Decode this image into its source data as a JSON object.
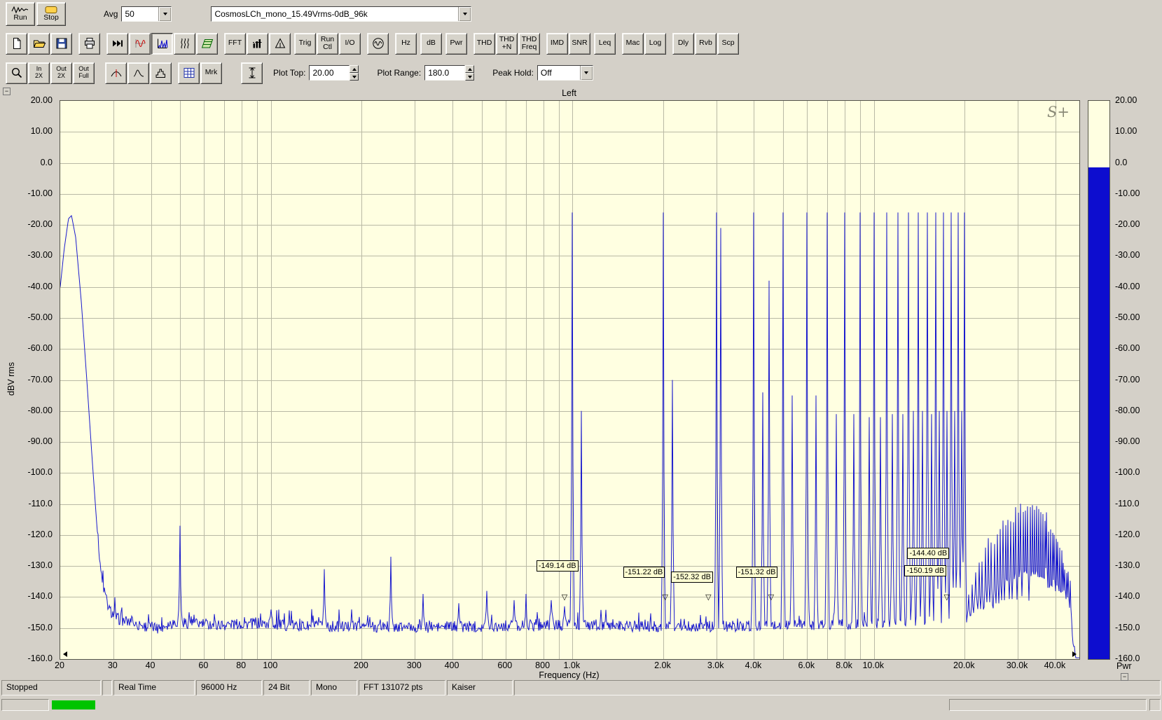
{
  "toolbar1": {
    "run_label": "Run",
    "stop_label": "Stop",
    "avg_label": "Avg",
    "avg_value": "50",
    "file_value": "CosmosLCh_mono_15.49Vrms-0dB_96k"
  },
  "toolbar2": {
    "buttons": [
      {
        "name": "new-file-button",
        "icon": "new-document-icon"
      },
      {
        "name": "open-file-button",
        "icon": "open-folder-icon"
      },
      {
        "name": "save-button",
        "icon": "save-icon"
      },
      {
        "name": "print-button",
        "icon": "printer-icon"
      },
      {
        "name": "process-button",
        "icon": "fast-forward-icon"
      },
      {
        "name": "time-series-view-button",
        "icon": "time-series-icon"
      },
      {
        "name": "spectrum-view-button",
        "icon": "spectrum-icon",
        "active": true
      },
      {
        "name": "spectrogram-view-button",
        "icon": "spectrogram-icon"
      },
      {
        "name": "surface-view-button",
        "icon": "surface-plot-icon"
      },
      {
        "name": "fft-settings-button",
        "label": "FFT"
      },
      {
        "name": "scaling-button",
        "icon": "bar-graph-icon"
      },
      {
        "name": "calibration-button",
        "icon": "triangle-icon"
      },
      {
        "name": "trigger-button",
        "label": "Trig"
      },
      {
        "name": "run-control-button",
        "label": "Run\nCtl"
      },
      {
        "name": "io-device-button",
        "label": "I/O"
      },
      {
        "name": "signal-generator-button",
        "icon": "sine-wave-icon"
      },
      {
        "name": "hz-button",
        "label": "Hz"
      },
      {
        "name": "db-button",
        "label": "dB"
      },
      {
        "name": "pwr-button",
        "label": "Pwr"
      },
      {
        "name": "thd-button",
        "label": "THD"
      },
      {
        "name": "thd-n-button",
        "label": "THD\n+N"
      },
      {
        "name": "thd-freq-button",
        "label": "THD\nFreq"
      },
      {
        "name": "imd-button",
        "label": "IMD"
      },
      {
        "name": "snr-button",
        "label": "SNR"
      },
      {
        "name": "leq-button",
        "label": "Leq"
      },
      {
        "name": "macro-button",
        "label": "Mac"
      },
      {
        "name": "log-button",
        "label": "Log"
      },
      {
        "name": "delay-button",
        "label": "Dly"
      },
      {
        "name": "reverb-button",
        "label": "Rvb"
      },
      {
        "name": "scope-button",
        "label": "Scp"
      }
    ]
  },
  "toolbar3": {
    "buttons": [
      {
        "name": "zoom-button",
        "icon": "magnifier-icon"
      },
      {
        "name": "zoom-in-2x-button",
        "label": "In\n2X"
      },
      {
        "name": "zoom-out-2x-button",
        "label": "Out\n2X"
      },
      {
        "name": "zoom-out-full-button",
        "label": "Out\nFull"
      },
      {
        "name": "marker-curve-button",
        "icon": "marker-curve-icon"
      },
      {
        "name": "smoothing-button",
        "icon": "peak-curve-icon"
      },
      {
        "name": "histogram-button",
        "icon": "histogram-icon"
      },
      {
        "name": "utilities-button",
        "icon": "grid-icon"
      },
      {
        "name": "marker-toggle-button",
        "label": "Mrk"
      },
      {
        "name": "plot-scale-button",
        "icon": "vertical-ruler-icon"
      }
    ],
    "plot_top_label": "Plot Top:",
    "plot_top_value": "20.00",
    "plot_range_label": "Plot Range:",
    "plot_range_value": "180.0",
    "peak_hold_label": "Peak Hold:",
    "peak_hold_value": "Off"
  },
  "plot": {
    "pwr_label": "Pwr",
    "logo_text": "S+"
  },
  "icons": {
    "marker_arrow": "▽",
    "collapse_glyph": "−"
  },
  "ui_colors": {
    "meter_green": "#00c400",
    "chrome": "#d4d0c8"
  },
  "chart_data": {
    "type": "line",
    "title": "Left",
    "xlabel": "Frequency (Hz)",
    "ylabel": "dBV rms",
    "x_scale": "log",
    "x_range_hz": [
      20,
      48000
    ],
    "y_range_db": [
      -160,
      20
    ],
    "plot_top_db": 20,
    "plot_range_db": 180,
    "peak_hold": "Off",
    "averages": 50,
    "trace_color": "#1a1acd",
    "grid_color": "#b9b9a5",
    "plot_bg": "#ffffe1",
    "pwr_bar_color": "#0d0dcf",
    "power_bar_db": -1.5,
    "y_ticks": [
      {
        "db": 20,
        "label": "20.00"
      },
      {
        "db": 10,
        "label": "10.00"
      },
      {
        "db": 0,
        "label": "0.0"
      },
      {
        "db": -10,
        "label": "-10.00"
      },
      {
        "db": -20,
        "label": "-20.00"
      },
      {
        "db": -30,
        "label": "-30.00"
      },
      {
        "db": -40,
        "label": "-40.00"
      },
      {
        "db": -50,
        "label": "-50.00"
      },
      {
        "db": -60,
        "label": "-60.00"
      },
      {
        "db": -70,
        "label": "-70.00"
      },
      {
        "db": -80,
        "label": "-80.00"
      },
      {
        "db": -90,
        "label": "-90.00"
      },
      {
        "db": -100,
        "label": "-100.0"
      },
      {
        "db": -110,
        "label": "-110.0"
      },
      {
        "db": -120,
        "label": "-120.0"
      },
      {
        "db": -130,
        "label": "-130.0"
      },
      {
        "db": -140,
        "label": "-140.0"
      },
      {
        "db": -150,
        "label": "-150.0"
      },
      {
        "db": -160,
        "label": "-160.0"
      }
    ],
    "x_ticks": [
      {
        "f": 20,
        "label": "20"
      },
      {
        "f": 30,
        "label": "30"
      },
      {
        "f": 40,
        "label": "40"
      },
      {
        "f": 60,
        "label": "60"
      },
      {
        "f": 80,
        "label": "80"
      },
      {
        "f": 100,
        "label": "100"
      },
      {
        "f": 200,
        "label": "200"
      },
      {
        "f": 300,
        "label": "300"
      },
      {
        "f": 400,
        "label": "400"
      },
      {
        "f": 600,
        "label": "600"
      },
      {
        "f": 800,
        "label": "800"
      },
      {
        "f": 1000,
        "label": "1.0k"
      },
      {
        "f": 2000,
        "label": "2.0k"
      },
      {
        "f": 3000,
        "label": "3.0k"
      },
      {
        "f": 4000,
        "label": "4.0k"
      },
      {
        "f": 6000,
        "label": "6.0k"
      },
      {
        "f": 8000,
        "label": "8.0k"
      },
      {
        "f": 10000,
        "label": "10.0k"
      },
      {
        "f": 20000,
        "label": "20.0k"
      },
      {
        "f": 30000,
        "label": "30.0k"
      },
      {
        "f": 40000,
        "label": "40.0k"
      }
    ],
    "noise_floor": [
      [
        20,
        -40
      ],
      [
        20.6,
        -28
      ],
      [
        21.3,
        -18
      ],
      [
        21.8,
        -17
      ],
      [
        22.5,
        -24
      ],
      [
        23.5,
        -45
      ],
      [
        24.5,
        -70
      ],
      [
        25.5,
        -95
      ],
      [
        26.5,
        -118
      ],
      [
        27.5,
        -135
      ],
      [
        29,
        -144
      ],
      [
        31,
        -147
      ],
      [
        36,
        -149
      ],
      [
        42,
        -150
      ],
      [
        48,
        -148
      ],
      [
        55,
        -148.5
      ],
      [
        70,
        -149
      ],
      [
        90,
        -148.5
      ],
      [
        130,
        -149.5
      ],
      [
        200,
        -149.5
      ],
      [
        300,
        -149.8
      ],
      [
        450,
        -149.5
      ],
      [
        650,
        -149.2
      ],
      [
        900,
        -149
      ],
      [
        1300,
        -149.3
      ],
      [
        2000,
        -149.5
      ],
      [
        3500,
        -149.4
      ],
      [
        6000,
        -149
      ],
      [
        9000,
        -148.6
      ],
      [
        13000,
        -148
      ],
      [
        17000,
        -147.4
      ],
      [
        20000,
        -147
      ],
      [
        24000,
        -146.3
      ],
      [
        30000,
        -145.8
      ],
      [
        36000,
        -146
      ],
      [
        40000,
        -146.8
      ],
      [
        43000,
        -148
      ],
      [
        44800,
        -150
      ],
      [
        45800,
        -154
      ],
      [
        46400,
        -159
      ],
      [
        47200,
        -164
      ],
      [
        48000,
        -168
      ]
    ],
    "peaks": [
      [
        50,
        -117
      ],
      [
        100,
        -144
      ],
      [
        150,
        -131
      ],
      [
        185,
        -144
      ],
      [
        250,
        -127
      ],
      [
        320,
        -139
      ],
      [
        420,
        -142
      ],
      [
        520,
        -138
      ],
      [
        640,
        -141
      ],
      [
        700,
        -139
      ],
      [
        850,
        -141
      ],
      [
        940,
        -143
      ],
      [
        1000,
        -16
      ],
      [
        1070,
        -80
      ],
      [
        2000,
        -16
      ],
      [
        2140,
        -70
      ],
      [
        3000,
        -16
      ],
      [
        3100,
        -21
      ],
      [
        4000,
        -16
      ],
      [
        4280,
        -74
      ],
      [
        4500,
        -38
      ],
      [
        5000,
        -16
      ],
      [
        5350,
        -75
      ],
      [
        6000,
        -16
      ],
      [
        6420,
        -75
      ],
      [
        7000,
        -16
      ],
      [
        7490,
        -81
      ],
      [
        8000,
        -16
      ],
      [
        8560,
        -81
      ],
      [
        9000,
        -16
      ],
      [
        9630,
        -82
      ],
      [
        10000,
        -16
      ],
      [
        10500,
        -82
      ],
      [
        11000,
        -16
      ],
      [
        11500,
        -81
      ],
      [
        12000,
        -16
      ],
      [
        12500,
        -81
      ],
      [
        13000,
        -16
      ],
      [
        13500,
        -80
      ],
      [
        14000,
        -16
      ],
      [
        14500,
        -80
      ],
      [
        15000,
        -16
      ],
      [
        15500,
        -81
      ],
      [
        16000,
        -16
      ],
      [
        16500,
        -80
      ],
      [
        17000,
        -16
      ],
      [
        17500,
        -80
      ],
      [
        18000,
        -16
      ],
      [
        18500,
        -80
      ],
      [
        19000,
        -16
      ],
      [
        19500,
        -80
      ],
      [
        20000,
        -16
      ]
    ],
    "hf_comb": {
      "start": 20600,
      "end": 45200,
      "step": 560,
      "envelope": [
        [
          20600,
          -137
        ],
        [
          22000,
          -129
        ],
        [
          24000,
          -123
        ],
        [
          26500,
          -118
        ],
        [
          29000,
          -114
        ],
        [
          31500,
          -111
        ],
        [
          33500,
          -109
        ],
        [
          35000,
          -110
        ],
        [
          37000,
          -114
        ],
        [
          39000,
          -119
        ],
        [
          41000,
          -124
        ],
        [
          43000,
          -129
        ],
        [
          44500,
          -134
        ],
        [
          45200,
          -138
        ]
      ]
    },
    "markers": [
      {
        "freq_hz": 950,
        "label": "-149.14 dB",
        "label_db": -130,
        "dx": -42,
        "arrow": true,
        "arrow_db": -140
      },
      {
        "freq_hz": 2050,
        "label": "-151.22 dB",
        "label_db": -132,
        "dx": -62,
        "arrow": true,
        "arrow_db": -140
      },
      {
        "freq_hz": 2850,
        "label": "-152.32 dB",
        "label_db": -133.5,
        "dx": -55,
        "arrow": true,
        "arrow_db": -140
      },
      {
        "freq_hz": 4600,
        "label": "-151.32 dB",
        "label_db": -132,
        "dx": -52,
        "arrow": true,
        "arrow_db": -140
      },
      {
        "freq_hz": 17600,
        "label": "-144.40 dB",
        "label_db": -126,
        "dx": -58,
        "arrow": false,
        "arrow_db": -140
      },
      {
        "freq_hz": 17600,
        "label": "-150.19 dB",
        "label_db": -131.5,
        "dx": -62,
        "arrow": true,
        "arrow_db": -140
      }
    ]
  },
  "status_bar": {
    "items": [
      "Stopped",
      "",
      "Real Time",
      "96000 Hz",
      "24 Bit",
      "Mono",
      "FFT 131072 pts",
      "Kaiser",
      ""
    ]
  }
}
